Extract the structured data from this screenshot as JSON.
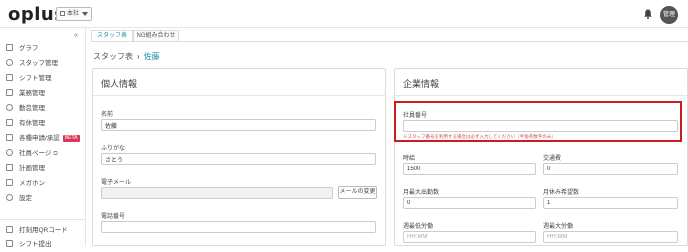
{
  "header": {
    "logo": "oplus",
    "store_select": "本社",
    "avatar_label": "管理"
  },
  "sidebar": {
    "collapse_label": "«",
    "items": [
      {
        "label": "グラフ",
        "icon": "graph-icon"
      },
      {
        "label": "スタッフ管理",
        "icon": "staff-icon"
      },
      {
        "label": "シフト管理",
        "icon": "shift-icon"
      },
      {
        "label": "業務管理",
        "icon": "task-icon"
      },
      {
        "label": "勤怠管理",
        "icon": "clock-icon"
      },
      {
        "label": "有休管理",
        "icon": "leave-icon"
      },
      {
        "label": "各種申請/承認",
        "icon": "approval-icon",
        "badge": "BETA"
      },
      {
        "label": "社員ページ",
        "icon": "employee-page-icon",
        "external": "⧉"
      },
      {
        "label": "計画管理",
        "icon": "plan-icon"
      },
      {
        "label": "メガホン",
        "icon": "megaphone-icon"
      },
      {
        "label": "設定",
        "icon": "settings-icon"
      },
      {
        "label": "打刻用QRコード",
        "icon": "qr-icon"
      },
      {
        "label": "シフト提出",
        "icon": "shift-submit-icon"
      }
    ]
  },
  "tabs": [
    {
      "label": "スタッフ表",
      "active": true
    },
    {
      "label": "NG組み合わせ",
      "active": false
    }
  ],
  "breadcrumb": {
    "parent": "スタッフ表",
    "current": "佐藤"
  },
  "personal": {
    "title": "個人情報",
    "name_label": "名前",
    "name_value": "佐藤",
    "kana_label": "ふりがな",
    "kana_value": "さとう",
    "email_label": "電子メール",
    "email_value": "",
    "email_change_button": "メールの変更",
    "phone_label": "電話番号",
    "phone_value": ""
  },
  "company": {
    "title": "企業情報",
    "employee_no_label": "社員番号",
    "employee_no_value": "",
    "employee_no_hint": "※スタッフ番号を利用する場合は必ず入力してください（半角英数字のみ）",
    "hourly_label": "時給",
    "hourly_value": "1500",
    "transport_label": "交通費",
    "transport_value": "0",
    "max_days_label": "月最大出勤数",
    "max_days_value": "0",
    "min_off_label": "月休み希望数",
    "min_off_value": "1",
    "weekly_min_label": "週最低労働",
    "weekly_min_placeholder": "HH:MM",
    "weekly_max_label": "週最大労働",
    "weekly_max_placeholder": "HH:MM"
  },
  "colors": {
    "accent": "#1a8fb0",
    "highlight": "#c81e1e",
    "beta": "#d8385a"
  }
}
